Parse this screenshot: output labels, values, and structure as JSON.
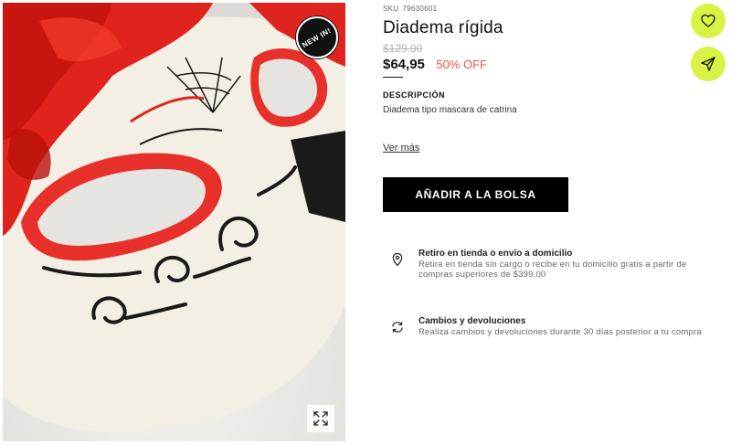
{
  "product": {
    "badge": "NEW IN!",
    "sku_label": "SKU",
    "sku": "79630601",
    "title": "Diadema rígida",
    "old_price": "$129.90",
    "price": "$64,95",
    "discount": "50% OFF"
  },
  "description": {
    "heading": "DESCRIPCIÓN",
    "text": "Diadema tipo mascara de catrina",
    "see_more": "Ver más"
  },
  "actions": {
    "add_to_bag": "AÑADIR A LA BOLSA"
  },
  "features": [
    {
      "icon": "location-pin-icon",
      "title": "Retiro en tienda o envío a domicilio",
      "text": "Retira en tienda sin cargo o recibe en tu domicilio gratis a partir de compras superiores de $399.00"
    },
    {
      "icon": "exchange-icon",
      "title": "Cambios y devoluciones",
      "text": "Realiza cambios y devoluciones durante 30 días posterior a tu compra"
    }
  ],
  "side_actions": {
    "favorite_icon": "heart-icon",
    "share_icon": "send-icon"
  },
  "colors": {
    "accent": "#d9f244",
    "discount": "#e0574f",
    "button": "#000000"
  }
}
